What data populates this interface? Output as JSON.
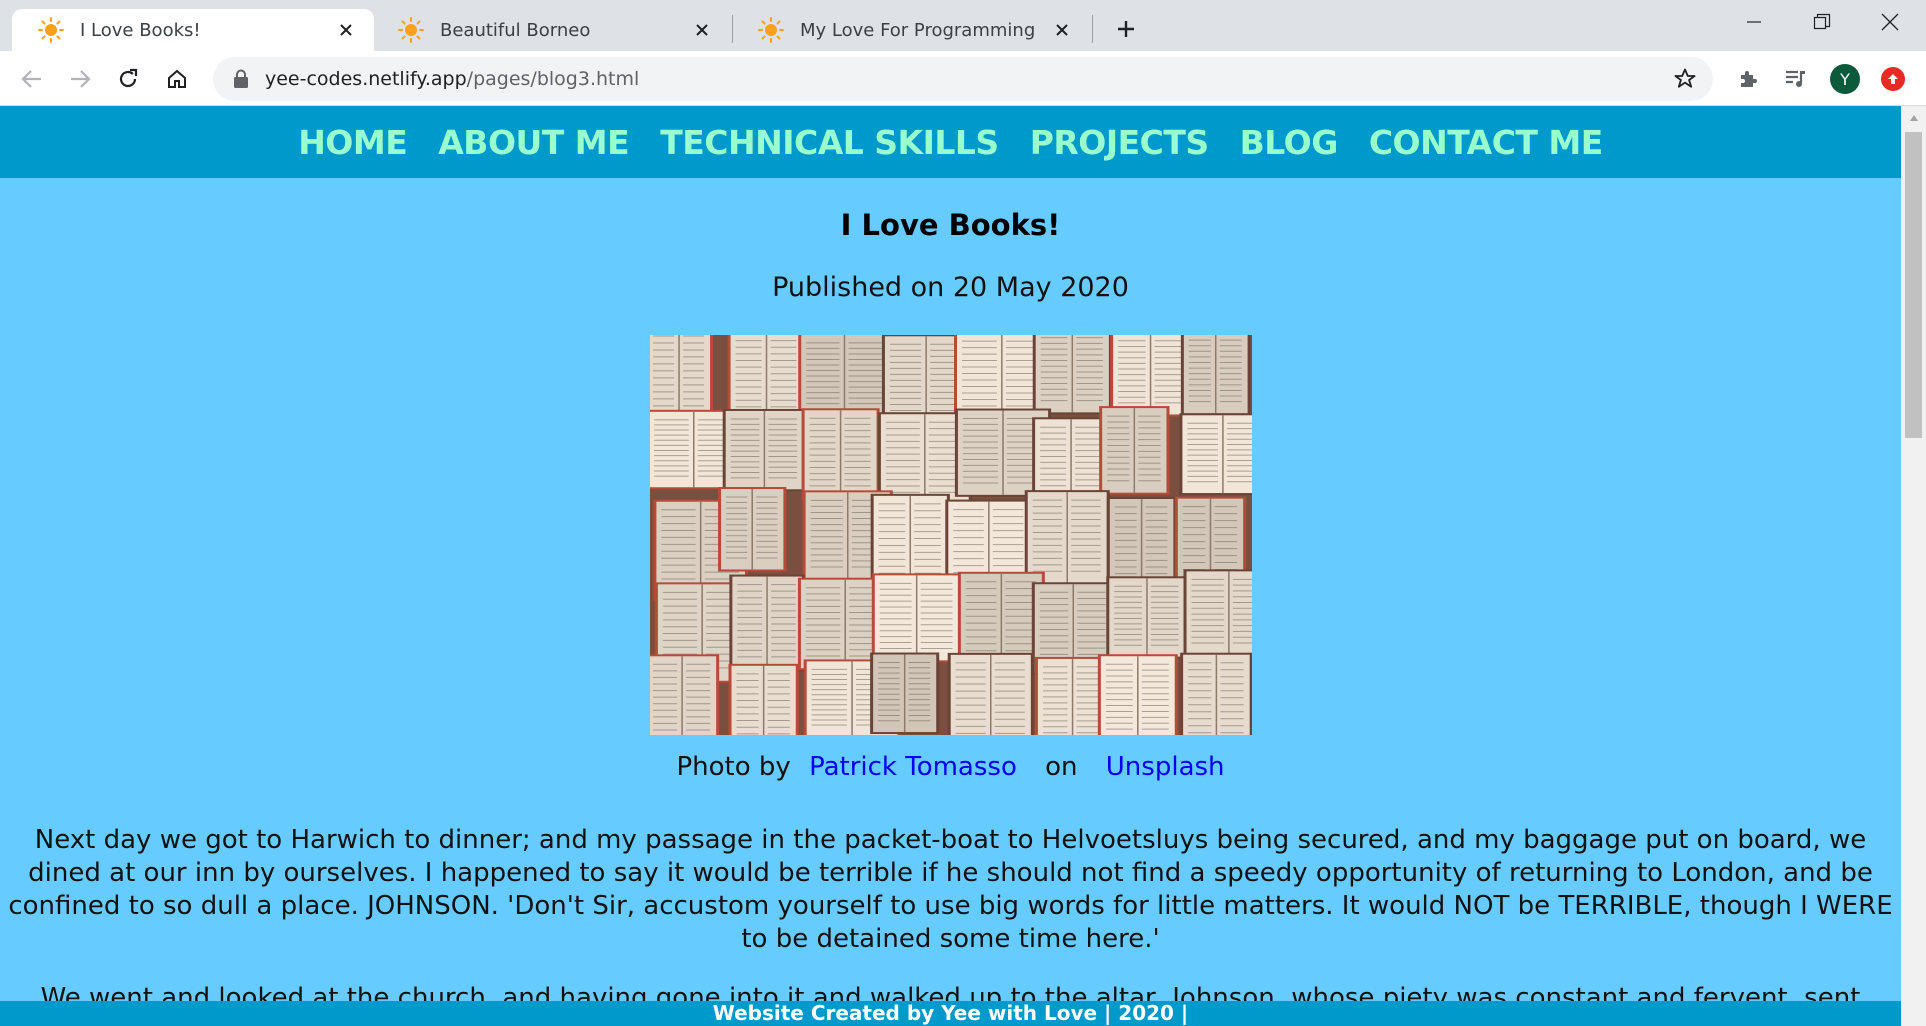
{
  "browser": {
    "tabs": [
      {
        "title": "I Love Books!",
        "active": true
      },
      {
        "title": "Beautiful Borneo",
        "active": false
      },
      {
        "title": "My Love For Programming",
        "active": false
      }
    ],
    "url": {
      "domain": "yee-codes.netlify.app",
      "path": "/pages/blog3.html"
    },
    "profile_initial": "Y"
  },
  "site": {
    "nav": [
      "HOME",
      "ABOUT ME",
      "TECHNICAL SKILLS",
      "PROJECTS",
      "BLOG",
      "CONTACT ME"
    ],
    "post": {
      "title": "I Love Books!",
      "published": "Published on 20 May 2020",
      "credit": {
        "prefix": "Photo by",
        "author": "Patrick Tomasso",
        "on": "on",
        "source": "Unsplash"
      },
      "paragraphs": [
        "Next day we got to Harwich to dinner; and my passage in the packet-boat to Helvoetsluys being secured, and my baggage put on board, we dined at our inn by ourselves. I happened to say it would be terrible if he should not find a speedy opportunity of returning to London, and be confined to so dull a place. JOHNSON. 'Don't Sir, accustom yourself to use big words for little matters. It would NOT be TERRIBLE, though I WERE to be detained some time here.'",
        "We went and looked at the church, and having gone into it and walked up to the altar, Johnson, whose piety was constant and fervent, sent"
      ]
    },
    "footer": "Website Created by Yee with Love | 2020 |"
  },
  "colors": {
    "page_bg": "#66ccff",
    "nav_bg": "#0099cc",
    "nav_text": "#99ffcc",
    "link": "#0000ee"
  }
}
